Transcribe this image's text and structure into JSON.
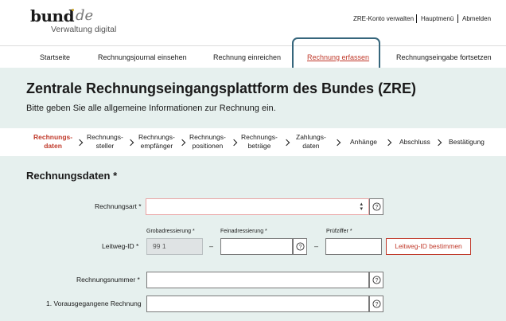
{
  "header": {
    "logo_main": "bund",
    "logo_suffix": "de",
    "logo_sub": "Verwaltung digital",
    "service_links": [
      "ZRE-Konto verwalten",
      "Hauptmenü",
      "Abmelden"
    ]
  },
  "nav": {
    "items": [
      "Startseite",
      "Rechnungsjournal einsehen",
      "Rechnung einreichen",
      "Rechnung erfassen",
      "Rechnungseingabe fortsetzen"
    ],
    "active_index": 3
  },
  "hero": {
    "title": "Zentrale Rechnungseingangsplattform des Bundes (ZRE)",
    "subtitle": "Bitte geben Sie alle allgemeine Informationen zur Rechnung ein."
  },
  "steps": {
    "items": [
      {
        "line1": "Rechnungs-",
        "line2": "daten"
      },
      {
        "line1": "Rechnungs-",
        "line2": "steller"
      },
      {
        "line1": "Rechnungs-",
        "line2": "empfänger"
      },
      {
        "line1": "Rechnungs-",
        "line2": "positionen"
      },
      {
        "line1": "Rechnungs-",
        "line2": "beträge"
      },
      {
        "line1": "Zahlungs-",
        "line2": "daten"
      },
      {
        "line1": "Anhänge",
        "line2": ""
      },
      {
        "line1": "Abschluss",
        "line2": ""
      },
      {
        "line1": "Bestätigung",
        "line2": ""
      }
    ],
    "active_index": 0
  },
  "form": {
    "section_title": "Rechnungsdaten *",
    "rechnungsart": {
      "label": "Rechnungsart *",
      "value": ""
    },
    "leitweg": {
      "label": "Leitweg-ID *",
      "grob_label": "Grobadressierung *",
      "grob_value": "99 1",
      "fein_label": "Feinadressierung *",
      "fein_value": "",
      "pruef_label": "Prüfziffer *",
      "pruef_value": "",
      "dash": "–",
      "button": "Leitweg-ID bestimmen"
    },
    "rechnungsnummer": {
      "label": "Rechnungsnummer *",
      "value": ""
    },
    "vorausgegangene": {
      "label": "1. Vorausgegangene Rechnung",
      "value": ""
    }
  },
  "colors": {
    "accent": "#c03a2b",
    "band": "#e6f0ee",
    "focus": "#36667c"
  },
  "icons": {
    "help": "help-circle-icon",
    "chevron": "chevron-right-icon",
    "select": "select-arrows-icon"
  }
}
